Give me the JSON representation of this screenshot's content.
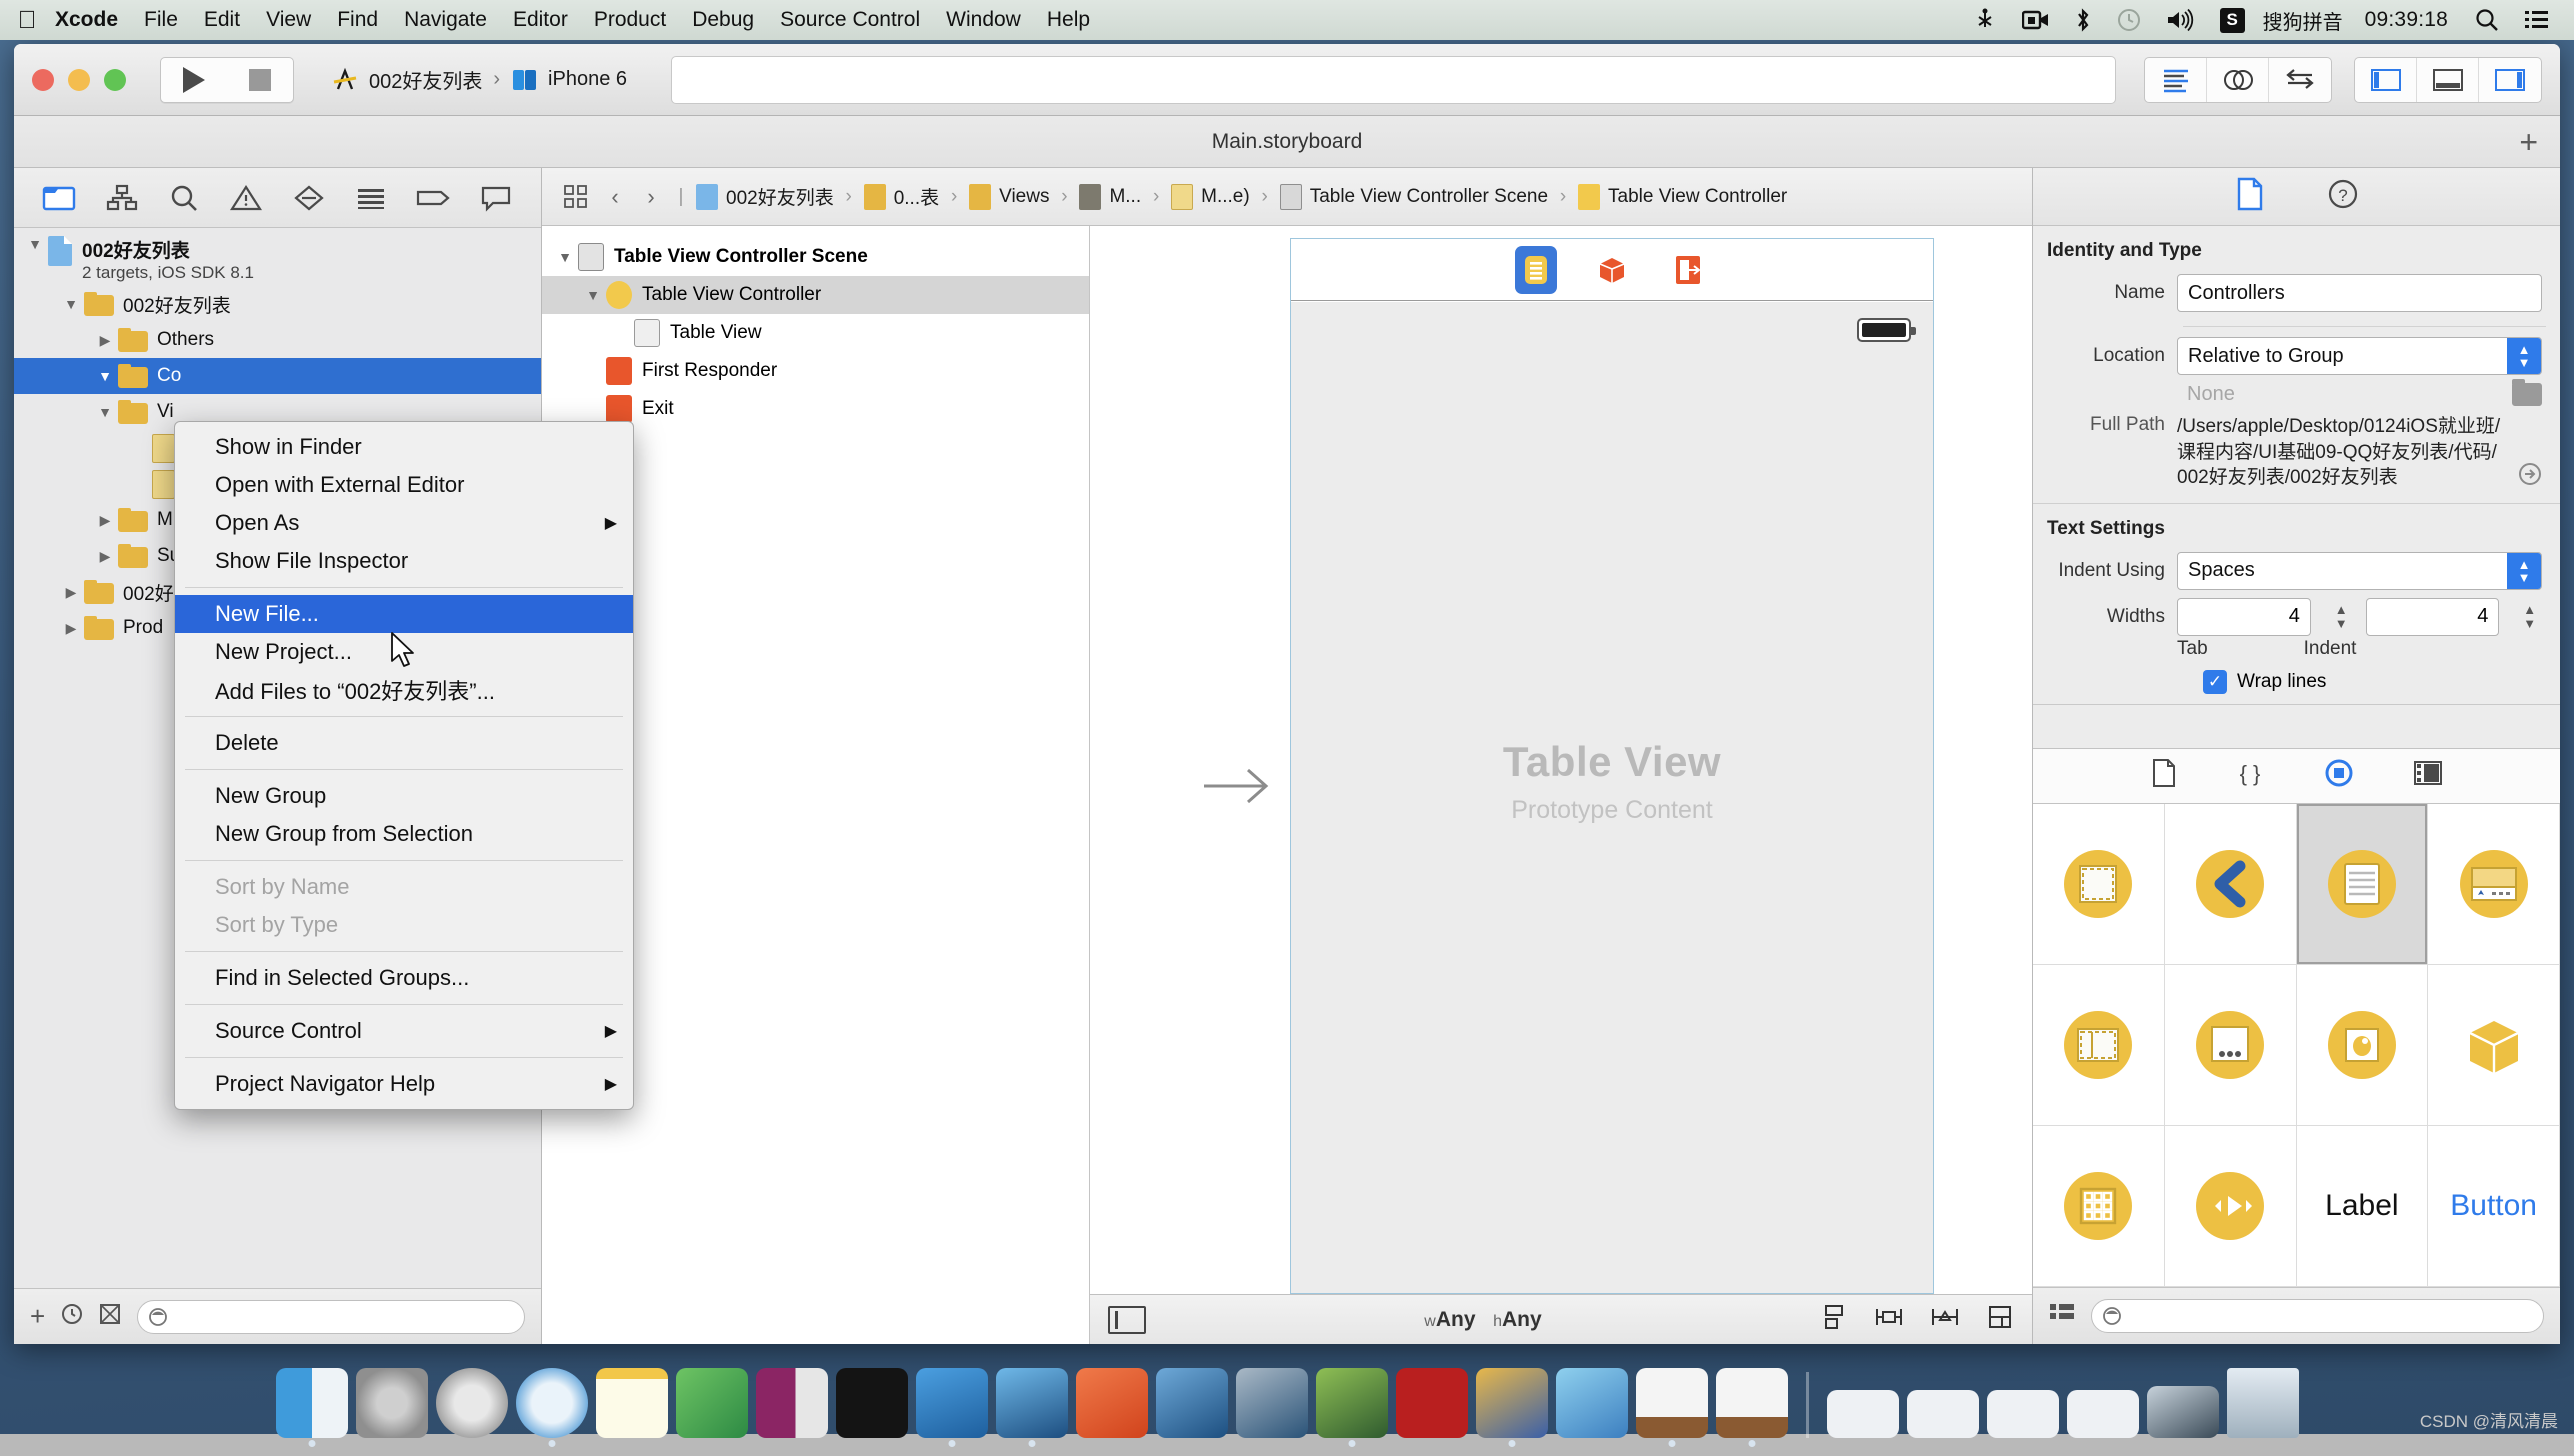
{
  "menubar": {
    "apple_icon": "apple-icon",
    "items": [
      "Xcode",
      "File",
      "Edit",
      "View",
      "Find",
      "Navigate",
      "Editor",
      "Product",
      "Debug",
      "Source Control",
      "Window",
      "Help"
    ],
    "status_icons": [
      "scissors-icon",
      "screen-record-icon",
      "bluetooth-icon",
      "time-machine-icon",
      "volume-icon"
    ],
    "ime_badge": "S",
    "ime_label": "搜狗拼音",
    "clock": "09:39:18",
    "search_icon": "search-icon",
    "notification_icon": "notification-center-icon"
  },
  "toolbar": {
    "run_button": "run-button",
    "stop_button": "stop-button",
    "scheme_project": "002好友列表",
    "scheme_sep": "›",
    "scheme_destination": "iPhone 6",
    "activity_placeholder": "",
    "editor_modes": [
      "standard-editor-icon",
      "assistant-editor-icon",
      "version-editor-icon"
    ],
    "view_toggles": [
      "navigator-toggle-icon",
      "debug-area-toggle-icon",
      "utilities-toggle-icon"
    ]
  },
  "document": {
    "title": "Main.storyboard",
    "add_label": "+"
  },
  "navigator": {
    "tabs": [
      "project-navigator-icon",
      "symbol-navigator-icon",
      "find-navigator-icon",
      "issue-navigator-icon",
      "test-navigator-icon",
      "debug-navigator-icon",
      "breakpoint-navigator-icon",
      "report-navigator-icon"
    ],
    "tree": [
      {
        "label": "002好友列表",
        "sub": "2 targets, iOS SDK 8.1",
        "kind": "project",
        "twisty": "down",
        "indent": 0
      },
      {
        "label": "002好友列表",
        "kind": "folder",
        "twisty": "down",
        "indent": 1
      },
      {
        "label": "Others",
        "kind": "folder",
        "twisty": "right",
        "indent": 2
      },
      {
        "label": "Co",
        "kind": "folder",
        "twisty": "down",
        "indent": 2,
        "selected": true
      },
      {
        "label": "Vi",
        "kind": "folder",
        "twisty": "down",
        "indent": 2
      },
      {
        "label": "",
        "kind": "file",
        "twisty": "none",
        "indent": 3
      },
      {
        "label": "",
        "kind": "file",
        "twisty": "none",
        "indent": 3
      },
      {
        "label": "M",
        "kind": "folder",
        "twisty": "right",
        "indent": 2
      },
      {
        "label": "Su",
        "kind": "folder",
        "twisty": "right",
        "indent": 2
      },
      {
        "label": "002好",
        "kind": "folder",
        "twisty": "right",
        "indent": 1
      },
      {
        "label": "Prod",
        "kind": "folder",
        "twisty": "right",
        "indent": 1
      }
    ],
    "filter_placeholder": "",
    "add_icon": "add-icon",
    "recent_icon": "recent-icon",
    "sourcecontrol_icon": "source-control-filter-icon"
  },
  "context_menu": {
    "items": [
      {
        "label": "Show in Finder"
      },
      {
        "label": "Open with External Editor"
      },
      {
        "label": "Open As",
        "submenu": true
      },
      {
        "label": "Show File Inspector"
      },
      {
        "sep": true
      },
      {
        "label": "New File...",
        "highlighted": true
      },
      {
        "label": "New Project..."
      },
      {
        "label": "Add Files to “002好友列表”..."
      },
      {
        "sep": true
      },
      {
        "label": "Delete"
      },
      {
        "sep": true
      },
      {
        "label": "New Group"
      },
      {
        "label": "New Group from Selection"
      },
      {
        "sep": true
      },
      {
        "label": "Sort by Name",
        "disabled": true
      },
      {
        "label": "Sort by Type",
        "disabled": true
      },
      {
        "sep": true
      },
      {
        "label": "Find in Selected Groups..."
      },
      {
        "sep": true
      },
      {
        "label": "Source Control",
        "submenu": true
      },
      {
        "sep": true
      },
      {
        "label": "Project Navigator Help",
        "submenu": true
      }
    ]
  },
  "jumpbar": {
    "related_icon": "related-items-icon",
    "back_arrow": "‹",
    "forward_arrow": "›",
    "separator": "›",
    "crumbs": [
      {
        "label": "002好友列表",
        "icon": "project-icon"
      },
      {
        "label": "0...表",
        "icon": "folder-icon"
      },
      {
        "label": "Views",
        "icon": "folder-icon"
      },
      {
        "label": "M...",
        "icon": "dark-folder-icon"
      },
      {
        "label": "M...e)",
        "icon": "storyboard-file-icon"
      },
      {
        "label": "Table View Controller Scene",
        "icon": "scene-icon"
      },
      {
        "label": "Table View Controller",
        "icon": "view-controller-icon"
      }
    ]
  },
  "outline": {
    "rows": [
      {
        "label": "Table View Controller Scene",
        "icon": "scene-icon",
        "twisty": "down",
        "indent": 0,
        "bold": true
      },
      {
        "label": "Table View Controller",
        "icon": "view-controller-icon",
        "twisty": "down",
        "indent": 1,
        "selected": true
      },
      {
        "label": "Table View",
        "icon": "table-view-icon",
        "twisty": "none",
        "indent": 2
      },
      {
        "label": "First Responder",
        "icon": "first-responder-icon",
        "twisty": "none",
        "indent": 1
      },
      {
        "label": "Exit",
        "icon": "exit-icon",
        "twisty": "none",
        "indent": 1
      }
    ],
    "filter_placeholder": ""
  },
  "canvas": {
    "dock_icons": [
      "view-controller-icon",
      "first-responder-icon",
      "exit-icon"
    ],
    "table_view_title": "Table View",
    "table_view_subtitle": "Prototype Content",
    "entry_arrow": "storyboard-entry-point-arrow",
    "bottom": {
      "left_toggle": "document-outline-toggle-icon",
      "size_class_w_prefix": "w",
      "size_class_w": "Any",
      "size_class_h_prefix": "h",
      "size_class_h": "Any",
      "buttons": [
        "align-icon",
        "pin-icon",
        "resolve-auto-layout-icon",
        "resizing-behavior-icon"
      ]
    }
  },
  "inspector": {
    "tabs": [
      "file-inspector-icon",
      "quick-help-icon"
    ],
    "identity_section": "Identity and Type",
    "name_label": "Name",
    "name_value": "Controllers",
    "location_label": "Location",
    "location_value": "Relative to Group",
    "location_none": "None",
    "folder_icon": "folder-icon",
    "fullpath_label": "Full Path",
    "fullpath_value": "/Users/apple/Desktop/0124iOS就业班/课程内容/UI基础09-QQ好友列表/代码/002好友列表/002好友列表",
    "reveal_icon": "reveal-in-finder-icon",
    "text_section": "Text Settings",
    "indent_label": "Indent Using",
    "indent_value": "Spaces",
    "widths_label": "Widths",
    "tab_width": "4",
    "indent_width": "4",
    "tab_sublabel": "Tab",
    "indent_sublabel": "Indent",
    "wrap_label": "Wrap lines",
    "wrap_checked": true
  },
  "library": {
    "tabs": [
      "file-template-library-icon",
      "code-snippet-library-icon",
      "object-library-icon",
      "media-library-icon"
    ],
    "selected_tab_index": 2,
    "items": [
      {
        "name": "view-object",
        "kind": "dashed-rect"
      },
      {
        "name": "back-chevron-object",
        "kind": "chevron"
      },
      {
        "name": "table-view-object",
        "kind": "lines",
        "selected": true
      },
      {
        "name": "table-view-cell-object",
        "kind": "cell"
      },
      {
        "name": "split-view-object",
        "kind": "dashed-split"
      },
      {
        "name": "page-control-object",
        "kind": "dots"
      },
      {
        "name": "image-view-object",
        "kind": "image"
      },
      {
        "name": "object-cube",
        "kind": "cube"
      },
      {
        "name": "collection-view-object",
        "kind": "grid"
      },
      {
        "name": "media-player-object",
        "kind": "player"
      },
      {
        "name": "label-object",
        "kind": "text",
        "text": "Label"
      },
      {
        "name": "button-object",
        "kind": "text-blue",
        "text": "Button"
      }
    ],
    "filter_placeholder": "",
    "list_toggle_icon": "list-view-toggle-icon"
  },
  "dock": {
    "apps": [
      {
        "name": "finder",
        "colors": [
          "#4aa8e0",
          "#f2f2f2"
        ],
        "running": true
      },
      {
        "name": "system-preferences",
        "colors": [
          "#8f8f8f",
          "#bdbdbd"
        ]
      },
      {
        "name": "launchpad",
        "colors": [
          "#dadada",
          "#9b9b9b"
        ]
      },
      {
        "name": "safari",
        "colors": [
          "#e8f1f8",
          "#3d8fd1"
        ],
        "running": true
      },
      {
        "name": "notes",
        "colors": [
          "#fdfbe8",
          "#f0c040"
        ]
      },
      {
        "name": "excel",
        "colors": [
          "#2d8a44",
          "#6ec464"
        ]
      },
      {
        "name": "onenote",
        "colors": [
          "#8b2564",
          "#d6d6d6"
        ]
      },
      {
        "name": "terminal",
        "colors": [
          "#141414",
          "#2a2a2a"
        ]
      },
      {
        "name": "xcode",
        "colors": [
          "#2a6fb5",
          "#9fd4ef"
        ],
        "running": true
      },
      {
        "name": "ios-simulator",
        "colors": [
          "#2a6fb5",
          "#1a1a1a"
        ],
        "running": true
      },
      {
        "name": "pycharm",
        "colors": [
          "#e8562c",
          "#f5f5f5"
        ]
      },
      {
        "name": "snipaste",
        "colors": [
          "#1d4f80",
          "#cfe6f7"
        ]
      },
      {
        "name": "quicktime",
        "colors": [
          "#2a5378",
          "#aab9c6"
        ]
      },
      {
        "name": "sequel-pro",
        "colors": [
          "#3b6f3b",
          "#8fbf55"
        ]
      },
      {
        "name": "filezilla",
        "colors": [
          "#b91f1f",
          "#f2f2f2"
        ],
        "running": false
      },
      {
        "name": "paint-tool",
        "colors": [
          "#e0a63a",
          "#3a5fa8"
        ],
        "running": true
      },
      {
        "name": "photoshop-brush",
        "colors": [
          "#3c7fc0",
          "#8fd0ee"
        ]
      },
      {
        "name": "illustrator-easel-1",
        "colors": [
          "#f4f4f4",
          "#8a5a32"
        ],
        "running": true
      },
      {
        "name": "illustrator-easel-2",
        "colors": [
          "#f4f4f4",
          "#8a5a32"
        ],
        "running": true
      },
      {
        "name": "recent-doc-1",
        "colors": [
          "#f0f0f0",
          "#d8d8d8"
        ]
      },
      {
        "name": "recent-doc-2",
        "colors": [
          "#f0f0f0",
          "#d8d8d8"
        ]
      },
      {
        "name": "recent-doc-3",
        "colors": [
          "#f0f0f0",
          "#d8d8d8"
        ]
      },
      {
        "name": "recent-doc-4",
        "colors": [
          "#f0f0f0",
          "#d8d8d8"
        ]
      },
      {
        "name": "screen-sharing",
        "colors": [
          "#c7d2db",
          "#3a4a57"
        ]
      },
      {
        "name": "trash",
        "colors": [
          "#d5dfe8",
          "#9fb0bd"
        ]
      }
    ]
  },
  "watermark": "CSDN @清风清晨"
}
